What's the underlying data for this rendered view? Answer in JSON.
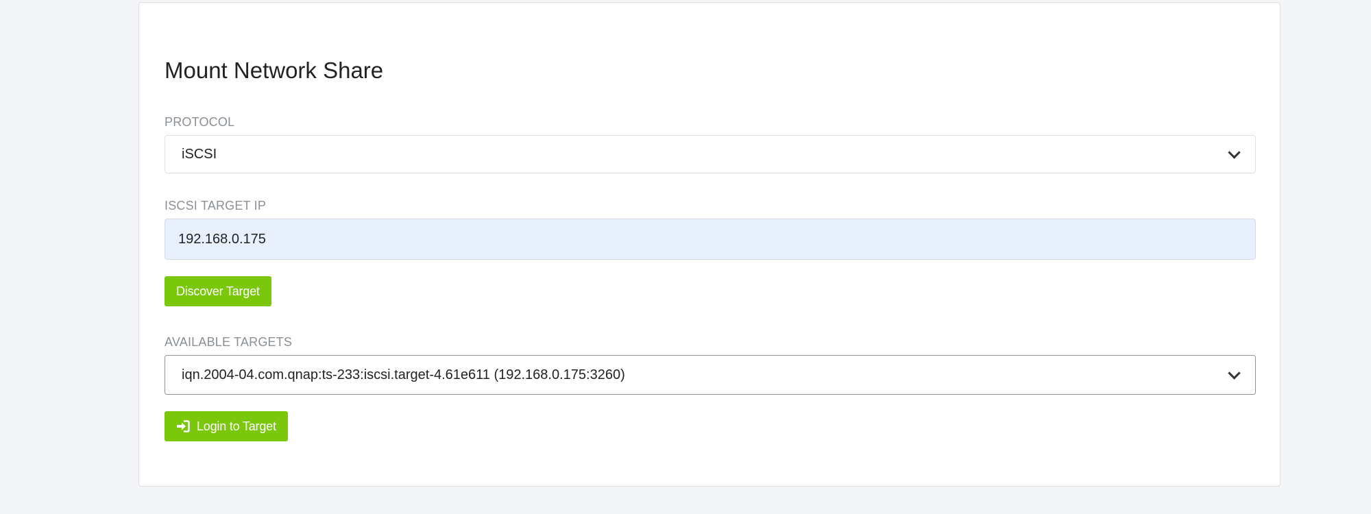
{
  "page": {
    "title": "Mount Network Share"
  },
  "protocol": {
    "label": "PROTOCOL",
    "selected": "iSCSI"
  },
  "target_ip": {
    "label": "ISCSI TARGET IP",
    "value": "192.168.0.175"
  },
  "discover_button": {
    "label": "Discover Target"
  },
  "available_targets": {
    "label": "AVAILABLE TARGETS",
    "selected": "iqn.2004-04.com.qnap:ts-233:iscsi.target-4.61e611 (192.168.0.175:3260)"
  },
  "login_button": {
    "label": "Login to Target",
    "icon": "sign-in-icon"
  },
  "colors": {
    "accent": "#7ac70c",
    "input_autofill_bg": "#e8f0fe",
    "page_bg": "#f4f5f7"
  }
}
